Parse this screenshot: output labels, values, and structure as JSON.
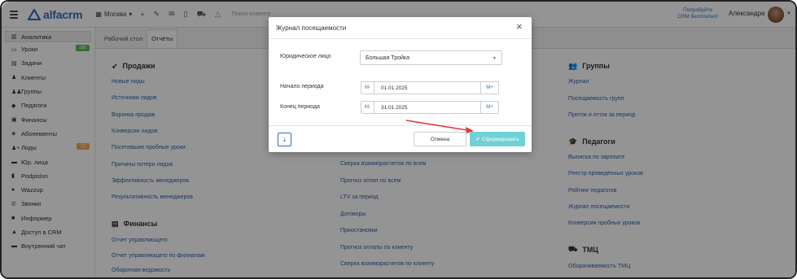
{
  "topbar": {
    "logo_text": "alfacrm",
    "city": "Москва",
    "search_placeholder": "Поиск клиента",
    "promo_line1": "Попробуйте",
    "promo_line2": "CRM бесплатно!",
    "username": "Александра"
  },
  "sidebar": {
    "items": [
      {
        "label": "Аналитика",
        "icon": "chart-icon"
      },
      {
        "label": "Уроки",
        "icon": "calendar-icon",
        "badge": "185",
        "badge_color": "#5cb85c"
      },
      {
        "label": "Задачи",
        "icon": "tasks-icon"
      },
      {
        "label": "Клиенты",
        "icon": "user-icon"
      },
      {
        "label": "Группы",
        "icon": "users-icon"
      },
      {
        "label": "Педагоги",
        "icon": "graduation-cap-icon"
      },
      {
        "label": "Финансы",
        "icon": "money-icon"
      },
      {
        "label": "Абонементы",
        "icon": "tag-icon"
      },
      {
        "label": "Лиды",
        "icon": "user-plus-icon",
        "badge": "23",
        "badge_color": "#f0ad4e"
      },
      {
        "label": "Юр. лица",
        "icon": "briefcase-icon"
      },
      {
        "label": "Podpislon",
        "icon": "document-icon"
      },
      {
        "label": "Wazzup",
        "icon": "whatsapp-icon"
      },
      {
        "label": "Звонки",
        "icon": "phone-icon"
      },
      {
        "label": "Информер",
        "icon": "informer-icon"
      },
      {
        "label": "Доступ в CRM",
        "icon": "lock-icon"
      },
      {
        "label": "Внутренний чат",
        "icon": "chat-icon"
      }
    ]
  },
  "tabs": [
    {
      "label": "Рабочий стол"
    },
    {
      "label": "Отчёты"
    }
  ],
  "columns": {
    "sales": {
      "title": "Продажи",
      "links": [
        "Новые лиды",
        "Источники лидов",
        "Воронка продаж",
        "Конверсии лидов",
        "Посетившие пробные уроки",
        "Причины потери лидов",
        "Эффективность менеджеров",
        "Результативность менеджеров"
      ]
    },
    "finance": {
      "title": "Финансы",
      "links": [
        "Отчет управляющего",
        "Отчет управляющего по филиалам",
        "Оборотная ведомость"
      ]
    },
    "middle": {
      "links": [
        "Сверка взаиморасчетов по всем",
        "Прогноз оплат по всем",
        "LTV за период",
        "Договоры",
        "Приостановки",
        "Прогноз оплаты по клиенту",
        "Сверка взаиморасчетов по клиенту"
      ]
    },
    "groups": {
      "title": "Группы",
      "links": [
        "Журнал",
        "Посещаемость групп",
        "Приток и отток за период"
      ]
    },
    "teachers": {
      "title": "Педагоги",
      "links": [
        "Выписка по зарплате",
        "Реестр проведённых уроков",
        "Рейтинг педагогов",
        "Журнал посещаемости",
        "Конверсия пробных уроков"
      ]
    },
    "tmc": {
      "title": "ТМЦ",
      "links": [
        "Оборачиваемость ТМЦ"
      ]
    }
  },
  "modal": {
    "title": "Журнал посещаемости",
    "close": "×",
    "legal_label": "Юридическое лицо",
    "legal_value": "Большая Тройка",
    "start_label": "Начало периода",
    "start_value": "01.01.2025",
    "end_label": "Конец периода",
    "end_value": "31.01.2025",
    "minus_label": "М-",
    "plus_label": "М+",
    "cancel_label": "Отмена",
    "submit_label": "Сформировать"
  },
  "colors": {
    "accent": "#2f6fc4",
    "submit": "#6fd1d6",
    "arrow": "#e03a3a"
  }
}
